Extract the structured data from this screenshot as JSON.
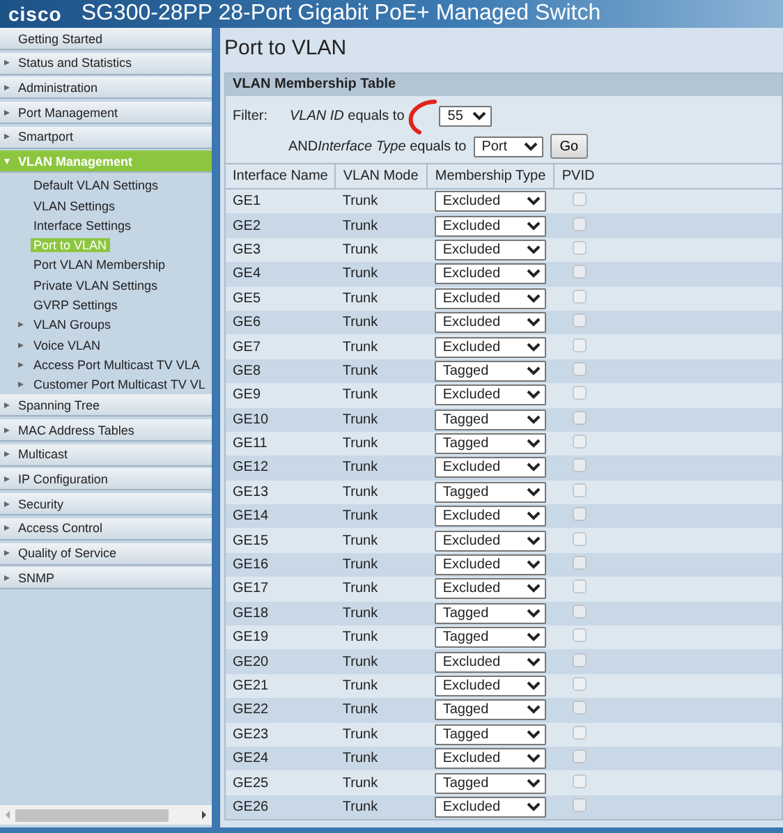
{
  "header": {
    "logo": "cisco",
    "title": "SG300-28PP 28-Port Gigabit PoE+ Managed Switch"
  },
  "sidebar": {
    "items": [
      {
        "label": "Getting Started",
        "kind": "link",
        "selected": false
      },
      {
        "label": "Status and Statistics",
        "kind": "folder",
        "expanded": false,
        "selected": false
      },
      {
        "label": "Administration",
        "kind": "folder",
        "expanded": false,
        "selected": false
      },
      {
        "label": "Port Management",
        "kind": "folder",
        "expanded": false,
        "selected": false
      },
      {
        "label": "Smartport",
        "kind": "folder",
        "expanded": false,
        "selected": false
      },
      {
        "label": "VLAN Management",
        "kind": "folder",
        "expanded": true,
        "selected": true,
        "children": [
          {
            "label": "Default VLAN Settings",
            "kind": "link",
            "selected": false
          },
          {
            "label": "VLAN Settings",
            "kind": "link",
            "selected": false
          },
          {
            "label": "Interface Settings",
            "kind": "link",
            "selected": false
          },
          {
            "label": "Port to VLAN",
            "kind": "link",
            "selected": true
          },
          {
            "label": "Port VLAN Membership",
            "kind": "link",
            "selected": false
          },
          {
            "label": "Private VLAN Settings",
            "kind": "link",
            "selected": false
          },
          {
            "label": "GVRP Settings",
            "kind": "link",
            "selected": false
          },
          {
            "label": "VLAN Groups",
            "kind": "folder",
            "selected": false
          },
          {
            "label": "Voice VLAN",
            "kind": "folder",
            "selected": false
          },
          {
            "label": "Access Port Multicast TV VLA",
            "kind": "folder",
            "selected": false
          },
          {
            "label": "Customer Port Multicast TV VL",
            "kind": "folder",
            "selected": false
          }
        ]
      },
      {
        "label": "Spanning Tree",
        "kind": "folder",
        "expanded": false,
        "selected": false
      },
      {
        "label": "MAC Address Tables",
        "kind": "folder",
        "expanded": false,
        "selected": false
      },
      {
        "label": "Multicast",
        "kind": "folder",
        "expanded": false,
        "selected": false
      },
      {
        "label": "IP Configuration",
        "kind": "folder",
        "expanded": false,
        "selected": false
      },
      {
        "label": "Security",
        "kind": "folder",
        "expanded": false,
        "selected": false
      },
      {
        "label": "Access Control",
        "kind": "folder",
        "expanded": false,
        "selected": false
      },
      {
        "label": "Quality of Service",
        "kind": "folder",
        "expanded": false,
        "selected": false
      },
      {
        "label": "SNMP",
        "kind": "folder",
        "expanded": false,
        "selected": false
      }
    ]
  },
  "page_title": "Port to VLAN",
  "table": {
    "title": "VLAN Membership Table",
    "filter": {
      "label": "Filter:",
      "vlan_id_label": "VLAN ID",
      "vlan_id_suffix": "equals to",
      "vlan_id": "55",
      "and_label": "AND",
      "type_label": "Interface Type",
      "type_suffix": "equals to",
      "type": "Port",
      "go": "Go"
    },
    "columns": [
      "Interface Name",
      "VLAN Mode",
      "Membership Type",
      "PVID"
    ],
    "pvid_disabled": true,
    "rows": [
      {
        "name": "GE1",
        "mode": "Trunk",
        "membership": "Excluded",
        "pvid_checked": false
      },
      {
        "name": "GE2",
        "mode": "Trunk",
        "membership": "Excluded",
        "pvid_checked": false
      },
      {
        "name": "GE3",
        "mode": "Trunk",
        "membership": "Excluded",
        "pvid_checked": false
      },
      {
        "name": "GE4",
        "mode": "Trunk",
        "membership": "Excluded",
        "pvid_checked": false
      },
      {
        "name": "GE5",
        "mode": "Trunk",
        "membership": "Excluded",
        "pvid_checked": false
      },
      {
        "name": "GE6",
        "mode": "Trunk",
        "membership": "Excluded",
        "pvid_checked": false
      },
      {
        "name": "GE7",
        "mode": "Trunk",
        "membership": "Excluded",
        "pvid_checked": false
      },
      {
        "name": "GE8",
        "mode": "Trunk",
        "membership": "Tagged",
        "pvid_checked": false
      },
      {
        "name": "GE9",
        "mode": "Trunk",
        "membership": "Excluded",
        "pvid_checked": false
      },
      {
        "name": "GE10",
        "mode": "Trunk",
        "membership": "Tagged",
        "pvid_checked": false
      },
      {
        "name": "GE11",
        "mode": "Trunk",
        "membership": "Tagged",
        "pvid_checked": false
      },
      {
        "name": "GE12",
        "mode": "Trunk",
        "membership": "Excluded",
        "pvid_checked": false
      },
      {
        "name": "GE13",
        "mode": "Trunk",
        "membership": "Tagged",
        "pvid_checked": false
      },
      {
        "name": "GE14",
        "mode": "Trunk",
        "membership": "Excluded",
        "pvid_checked": false
      },
      {
        "name": "GE15",
        "mode": "Trunk",
        "membership": "Excluded",
        "pvid_checked": false
      },
      {
        "name": "GE16",
        "mode": "Trunk",
        "membership": "Excluded",
        "pvid_checked": false
      },
      {
        "name": "GE17",
        "mode": "Trunk",
        "membership": "Excluded",
        "pvid_checked": false
      },
      {
        "name": "GE18",
        "mode": "Trunk",
        "membership": "Tagged",
        "pvid_checked": false
      },
      {
        "name": "GE19",
        "mode": "Trunk",
        "membership": "Tagged",
        "pvid_checked": false
      },
      {
        "name": "GE20",
        "mode": "Trunk",
        "membership": "Excluded",
        "pvid_checked": false
      },
      {
        "name": "GE21",
        "mode": "Trunk",
        "membership": "Excluded",
        "pvid_checked": false
      },
      {
        "name": "GE22",
        "mode": "Trunk",
        "membership": "Tagged",
        "pvid_checked": false
      },
      {
        "name": "GE23",
        "mode": "Trunk",
        "membership": "Tagged",
        "pvid_checked": false
      },
      {
        "name": "GE24",
        "mode": "Trunk",
        "membership": "Excluded",
        "pvid_checked": false
      },
      {
        "name": "GE25",
        "mode": "Trunk",
        "membership": "Tagged",
        "pvid_checked": false
      },
      {
        "name": "GE26",
        "mode": "Trunk",
        "membership": "Excluded",
        "pvid_checked": false
      }
    ]
  }
}
